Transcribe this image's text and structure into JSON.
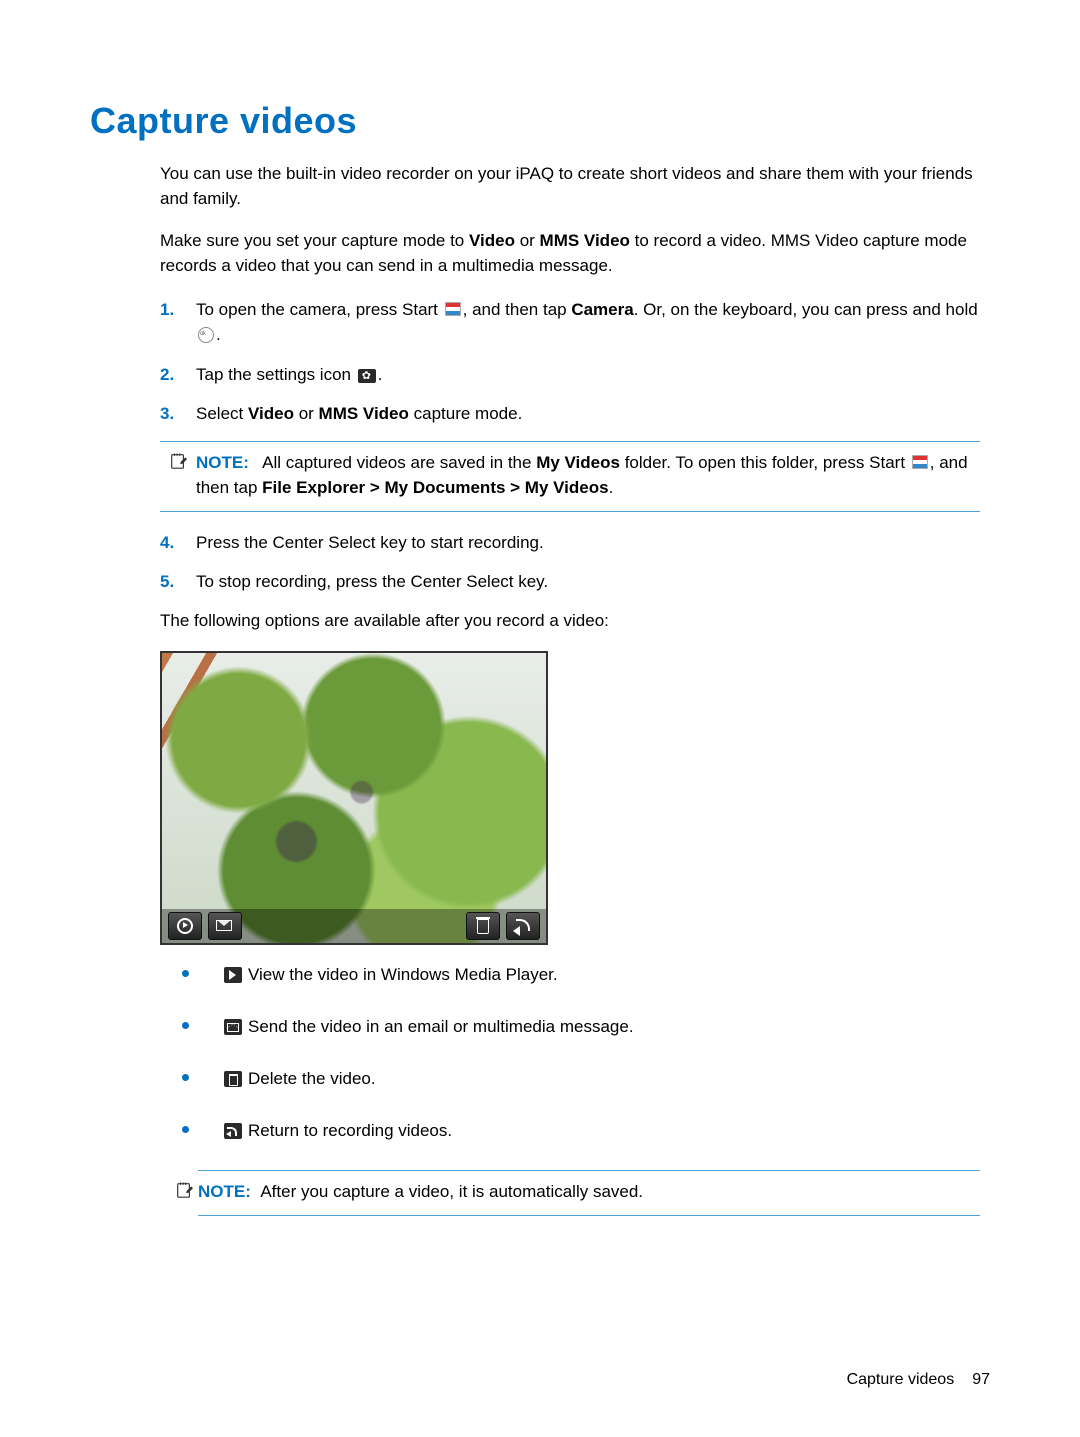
{
  "title": "Capture videos",
  "intro1": "You can use the built-in video recorder on your iPAQ to create short videos and share them with your friends and family.",
  "intro2_a": "Make sure you set your capture mode to ",
  "intro2_b_video": "Video",
  "intro2_c": " or ",
  "intro2_d_mms": "MMS Video",
  "intro2_e": " to record a video. MMS Video capture mode records a video that you can send in a multimedia message.",
  "steps": {
    "s1_a": "To open the camera, press Start ",
    "s1_b": ", and then tap ",
    "s1_camera": "Camera",
    "s1_c": ". Or, on the keyboard, you can press and hold ",
    "s1_d": ".",
    "s2_a": "Tap the settings icon ",
    "s2_b": ".",
    "s3_a": "Select ",
    "s3_video": "Video",
    "s3_or": " or ",
    "s3_mms": "MMS Video",
    "s3_b": " capture mode.",
    "s4": "Press the Center Select key to start recording.",
    "s5": "To stop recording, press the Center Select key."
  },
  "note1": {
    "label": "NOTE:",
    "a": "All captured videos are saved in the ",
    "myvideos": "My Videos",
    "b": " folder. To open this folder, press Start ",
    "c": ", and then tap ",
    "path": "File Explorer > My Documents > My Videos",
    "d": "."
  },
  "after_record": "The following options are available after you record a video:",
  "options": {
    "play": "View the video in Windows Media Player.",
    "send": "Send the video in an email or multimedia message.",
    "delete": "Delete the video.",
    "return": "Return to recording videos."
  },
  "note2": {
    "label": "NOTE:",
    "text": "After you capture a video, it is automatically saved."
  },
  "footer": {
    "section": "Capture videos",
    "page": "97"
  }
}
